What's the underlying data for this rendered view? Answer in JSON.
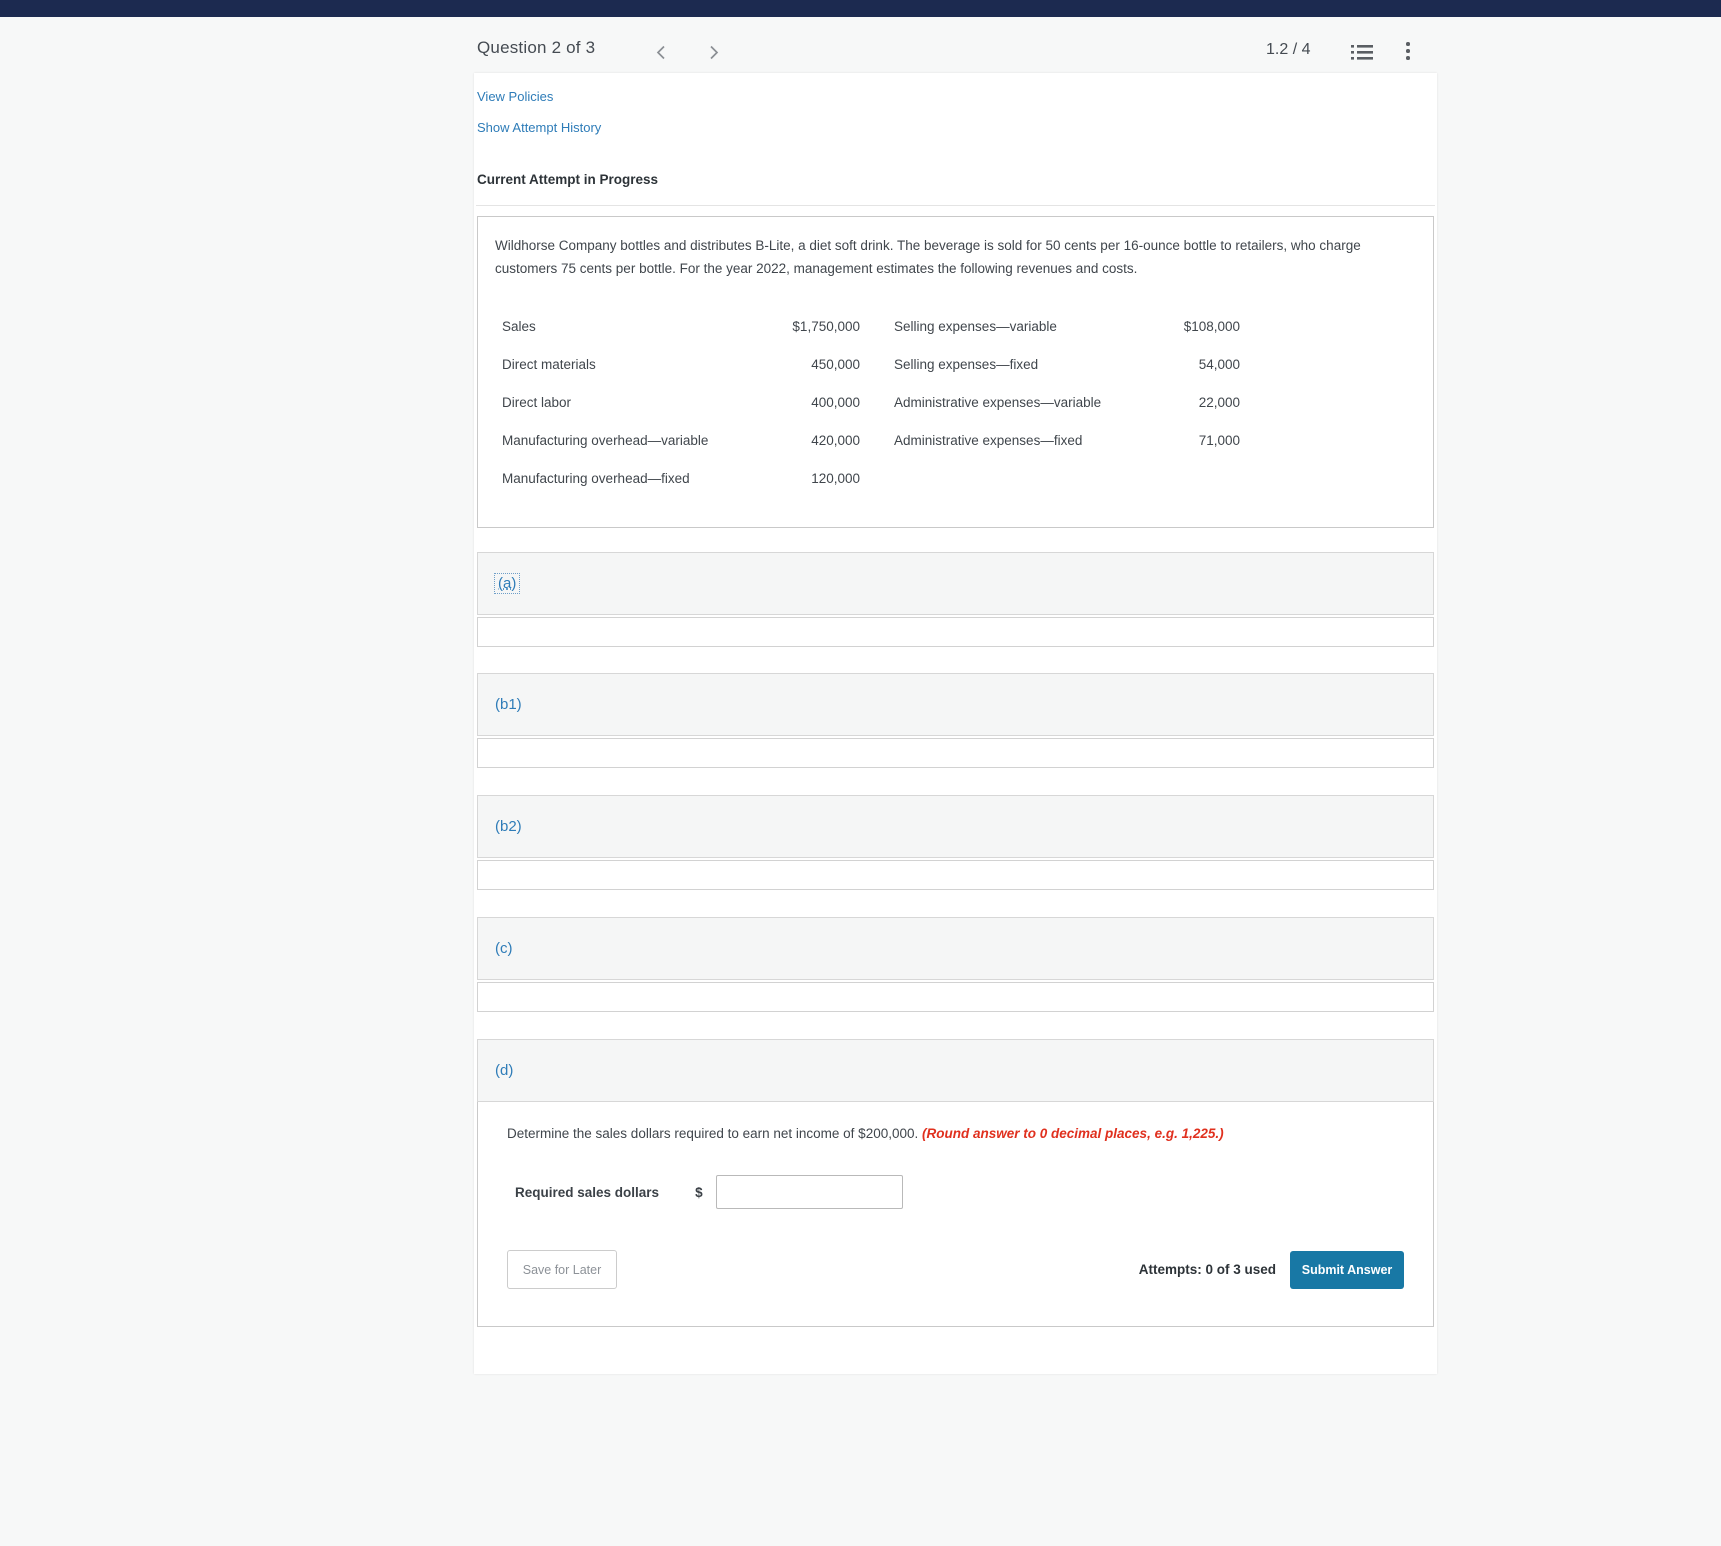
{
  "header": {
    "question_counter": "Question 2 of 3",
    "score": "1.2 / 4"
  },
  "links": {
    "view_policies": "View Policies",
    "show_attempt_history": "Show Attempt History"
  },
  "attempt": {
    "current_label": "Current Attempt in Progress"
  },
  "question": {
    "paragraph": "Wildhorse Company bottles and distributes B-Lite, a diet soft drink. The beverage is sold for 50 cents per 16-ounce bottle to retailers, who charge customers 75 cents per bottle. For the year 2022, management estimates the following revenues and costs.",
    "table": {
      "rows": [
        [
          "Sales",
          "$1,750,000",
          "Selling expenses—variable",
          "$108,000"
        ],
        [
          "Direct materials",
          "450,000",
          "Selling expenses—fixed",
          "54,000"
        ],
        [
          "Direct labor",
          "400,000",
          "Administrative expenses—variable",
          "22,000"
        ],
        [
          "Manufacturing overhead—variable",
          "420,000",
          "Administrative expenses—fixed",
          "71,000"
        ],
        [
          "Manufacturing overhead—fixed",
          "120,000",
          "",
          ""
        ]
      ]
    }
  },
  "sections": [
    {
      "label": "(a)"
    },
    {
      "label": "(b1)"
    },
    {
      "label": "(b2)"
    },
    {
      "label": "(c)"
    },
    {
      "label": "(d)"
    }
  ],
  "part_d": {
    "prompt_main": "Determine the sales dollars required to earn net income of $200,000. ",
    "prompt_note": "(Round answer to 0 decimal places, e.g. 1,225.)",
    "input_label": "Required sales dollars",
    "currency_symbol": "$",
    "input_value": "",
    "save_button": "Save for Later",
    "attempts_text": "Attempts: 0 of 3 used",
    "submit_button": "Submit Answer"
  },
  "colors": {
    "topbar_navy": "#1c2a50",
    "link_blue": "#2e7cb8",
    "submit_blue": "#1878a5",
    "note_red": "#e0301e"
  }
}
